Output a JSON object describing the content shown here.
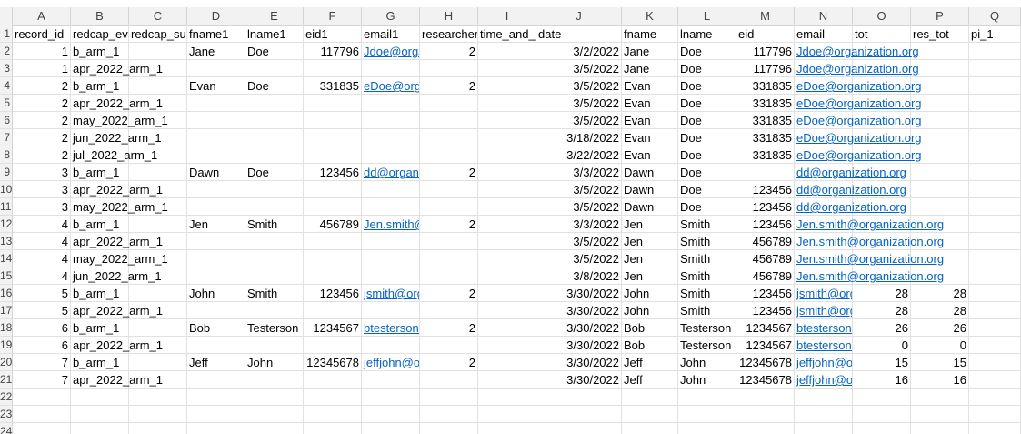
{
  "sheet": {
    "columns": [
      "A",
      "B",
      "C",
      "D",
      "E",
      "F",
      "G",
      "H",
      "I",
      "J",
      "K",
      "L",
      "M",
      "N",
      "O",
      "P",
      "Q"
    ],
    "rows": [
      {
        "num": "1",
        "cells": [
          "record_id",
          "redcap_event_name",
          "redcap_survey_identifier",
          "fname1",
          "lname1",
          "eid1",
          "email1",
          "researcher",
          "time_and_date",
          "date",
          "fname",
          "lname",
          "eid",
          "email",
          "tot",
          "res_tot",
          "pi_1"
        ]
      },
      {
        "num": "2",
        "cells": [
          "1",
          "b_arm_1",
          "",
          "Jane",
          "Doe",
          "117796",
          "Jdoe@organization.org",
          "2",
          "",
          "3/2/2022",
          "Jane",
          "Doe",
          "117796",
          "Jdoe@organization.org",
          "",
          "",
          ""
        ]
      },
      {
        "num": "3",
        "cells": [
          "1",
          "apr_2022_arm_1",
          "",
          "",
          "",
          "",
          "",
          "",
          "",
          "3/5/2022",
          "Jane",
          "Doe",
          "117796",
          "Jdoe@organization.org",
          "",
          "",
          ""
        ]
      },
      {
        "num": "4",
        "cells": [
          "2",
          "b_arm_1",
          "",
          "Evan",
          "Doe",
          "331835",
          "eDoe@organization.org",
          "2",
          "",
          "3/5/2022",
          "Evan",
          "Doe",
          "331835",
          "eDoe@organization.org",
          "",
          "",
          ""
        ]
      },
      {
        "num": "5",
        "cells": [
          "2",
          "apr_2022_arm_1",
          "",
          "",
          "",
          "",
          "",
          "",
          "",
          "3/5/2022",
          "Evan",
          "Doe",
          "331835",
          "eDoe@organization.org",
          "",
          "",
          ""
        ]
      },
      {
        "num": "6",
        "cells": [
          "2",
          "may_2022_arm_1",
          "",
          "",
          "",
          "",
          "",
          "",
          "",
          "3/5/2022",
          "Evan",
          "Doe",
          "331835",
          "eDoe@organization.org",
          "",
          "",
          ""
        ]
      },
      {
        "num": "7",
        "cells": [
          "2",
          "jun_2022_arm_1",
          "",
          "",
          "",
          "",
          "",
          "",
          "",
          "3/18/2022",
          "Evan",
          "Doe",
          "331835",
          "eDoe@organization.org",
          "",
          "",
          ""
        ]
      },
      {
        "num": "8",
        "cells": [
          "2",
          "jul_2022_arm_1",
          "",
          "",
          "",
          "",
          "",
          "",
          "",
          "3/22/2022",
          "Evan",
          "Doe",
          "331835",
          "eDoe@organization.org",
          "",
          "",
          ""
        ]
      },
      {
        "num": "9",
        "cells": [
          "3",
          "b_arm_1",
          "",
          "Dawn",
          "Doe",
          "123456",
          "dd@organization.org",
          "2",
          "",
          "3/3/2022",
          "Dawn",
          "Doe",
          "",
          "dd@organization.org",
          "",
          "",
          ""
        ]
      },
      {
        "num": "10",
        "cells": [
          "3",
          "apr_2022_arm_1",
          "",
          "",
          "",
          "",
          "",
          "",
          "",
          "3/5/2022",
          "Dawn",
          "Doe",
          "123456",
          "dd@organization.org",
          "",
          "",
          ""
        ]
      },
      {
        "num": "11",
        "cells": [
          "3",
          "may_2022_arm_1",
          "",
          "",
          "",
          "",
          "",
          "",
          "",
          "3/5/2022",
          "Dawn",
          "Doe",
          "123456",
          "dd@organization.org",
          "",
          "",
          ""
        ]
      },
      {
        "num": "12",
        "cells": [
          "4",
          "b_arm_1",
          "",
          "Jen",
          "Smith",
          "456789",
          "Jen.smith@organization.org",
          "2",
          "",
          "3/3/2022",
          "Jen",
          "Smith",
          "123456",
          "Jen.smith@organization.org",
          "",
          "",
          ""
        ]
      },
      {
        "num": "13",
        "cells": [
          "4",
          "apr_2022_arm_1",
          "",
          "",
          "",
          "",
          "",
          "",
          "",
          "3/5/2022",
          "Jen",
          "Smith",
          "456789",
          "Jen.smith@organization.org",
          "",
          "",
          ""
        ]
      },
      {
        "num": "14",
        "cells": [
          "4",
          "may_2022_arm_1",
          "",
          "",
          "",
          "",
          "",
          "",
          "",
          "3/5/2022",
          "Jen",
          "Smith",
          "456789",
          "Jen.smith@organization.org",
          "",
          "",
          ""
        ]
      },
      {
        "num": "15",
        "cells": [
          "4",
          "jun_2022_arm_1",
          "",
          "",
          "",
          "",
          "",
          "",
          "",
          "3/8/2022",
          "Jen",
          "Smith",
          "456789",
          "Jen.smith@organization.org",
          "",
          "",
          ""
        ]
      },
      {
        "num": "16",
        "cells": [
          "5",
          "b_arm_1",
          "",
          "John",
          "Smith",
          "123456",
          "jsmith@organization.org",
          "2",
          "",
          "3/30/2022",
          "John",
          "Smith",
          "123456",
          "jsmith@organization.org",
          "28",
          "28",
          ""
        ]
      },
      {
        "num": "17",
        "cells": [
          "5",
          "apr_2022_arm_1",
          "",
          "",
          "",
          "",
          "",
          "",
          "",
          "3/30/2022",
          "John",
          "Smith",
          "123456",
          "jsmith@organization.org",
          "28",
          "28",
          ""
        ]
      },
      {
        "num": "18",
        "cells": [
          "6",
          "b_arm_1",
          "",
          "Bob",
          "Testerson",
          "1234567",
          "btesterson@organization.org",
          "2",
          "",
          "3/30/2022",
          "Bob",
          "Testerson",
          "1234567",
          "btesterson@organization.org",
          "26",
          "26",
          ""
        ]
      },
      {
        "num": "19",
        "cells": [
          "6",
          "apr_2022_arm_1",
          "",
          "",
          "",
          "",
          "",
          "",
          "",
          "3/30/2022",
          "Bob",
          "Testerson",
          "1234567",
          "btesterson@organization.org",
          "0",
          "0",
          ""
        ]
      },
      {
        "num": "20",
        "cells": [
          "7",
          "b_arm_1",
          "",
          "Jeff",
          "John",
          "12345678",
          "jeffjohn@organization.org",
          "2",
          "",
          "3/30/2022",
          "Jeff",
          "John",
          "12345678",
          "jeffjohn@organization.org",
          "15",
          "15",
          ""
        ]
      },
      {
        "num": "21",
        "cells": [
          "7",
          "apr_2022_arm_1",
          "",
          "",
          "",
          "",
          "",
          "",
          "",
          "3/30/2022",
          "Jeff",
          "John",
          "12345678",
          "jeffjohn@organization.org",
          "16",
          "16",
          ""
        ]
      },
      {
        "num": "22",
        "cells": [
          "",
          "",
          "",
          "",
          "",
          "",
          "",
          "",
          "",
          "",
          "",
          "",
          "",
          "",
          "",
          "",
          ""
        ]
      },
      {
        "num": "23",
        "cells": [
          "",
          "",
          "",
          "",
          "",
          "",
          "",
          "",
          "",
          "",
          "",
          "",
          "",
          "",
          "",
          "",
          ""
        ]
      },
      {
        "num": "24",
        "cells": [
          "",
          "",
          "",
          "",
          "",
          "",
          "",
          "",
          "",
          "",
          "",
          "",
          "",
          "",
          "",
          "",
          ""
        ]
      }
    ]
  },
  "colors": {
    "link": "#0563c1",
    "header_bg": "#f2f2f2",
    "gridline": "#e1e1e1"
  }
}
